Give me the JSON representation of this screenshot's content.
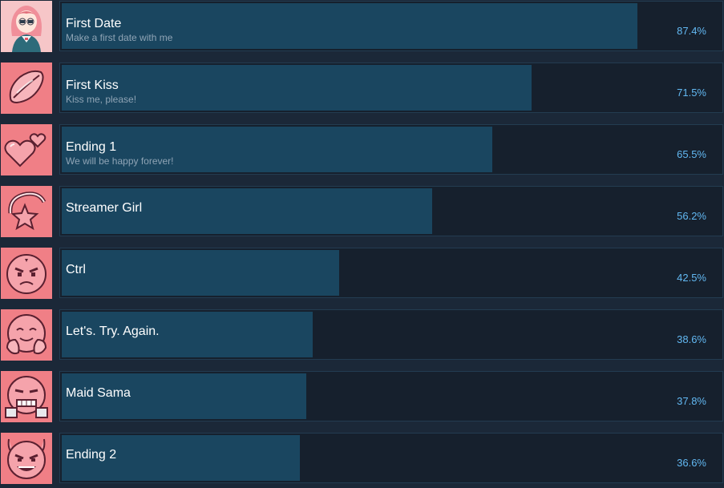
{
  "achievements": [
    {
      "title": "First Date",
      "description": "Make a first date with me",
      "percent": 87.4,
      "percent_label": "87.4%",
      "icon": "anime-girl-portrait-icon"
    },
    {
      "title": "First Kiss",
      "description": "Kiss me, please!",
      "percent": 71.5,
      "percent_label": "71.5%",
      "icon": "lips-icon"
    },
    {
      "title": "Ending 1",
      "description": "We will be happy forever!",
      "percent": 65.5,
      "percent_label": "65.5%",
      "icon": "two-hearts-icon"
    },
    {
      "title": "Streamer Girl",
      "description": "",
      "percent": 56.2,
      "percent_label": "56.2%",
      "icon": "shooting-star-icon"
    },
    {
      "title": "Ctrl",
      "description": "",
      "percent": 42.5,
      "percent_label": "42.5%",
      "icon": "angry-face-icon"
    },
    {
      "title": "Let's. Try. Again.",
      "description": "",
      "percent": 38.6,
      "percent_label": "38.6%",
      "icon": "smiling-face-hands-icon"
    },
    {
      "title": "Maid Sama",
      "description": "",
      "percent": 37.8,
      "percent_label": "37.8%",
      "icon": "grinning-face-icon"
    },
    {
      "title": "Ending 2",
      "description": "",
      "percent": 36.6,
      "percent_label": "36.6%",
      "icon": "devil-face-icon"
    }
  ],
  "colors": {
    "background": "#1b2838",
    "panel": "#16202d",
    "fill": "#1a4660",
    "percent_text": "#62b8f2",
    "icon_bg": "#f07f86"
  }
}
